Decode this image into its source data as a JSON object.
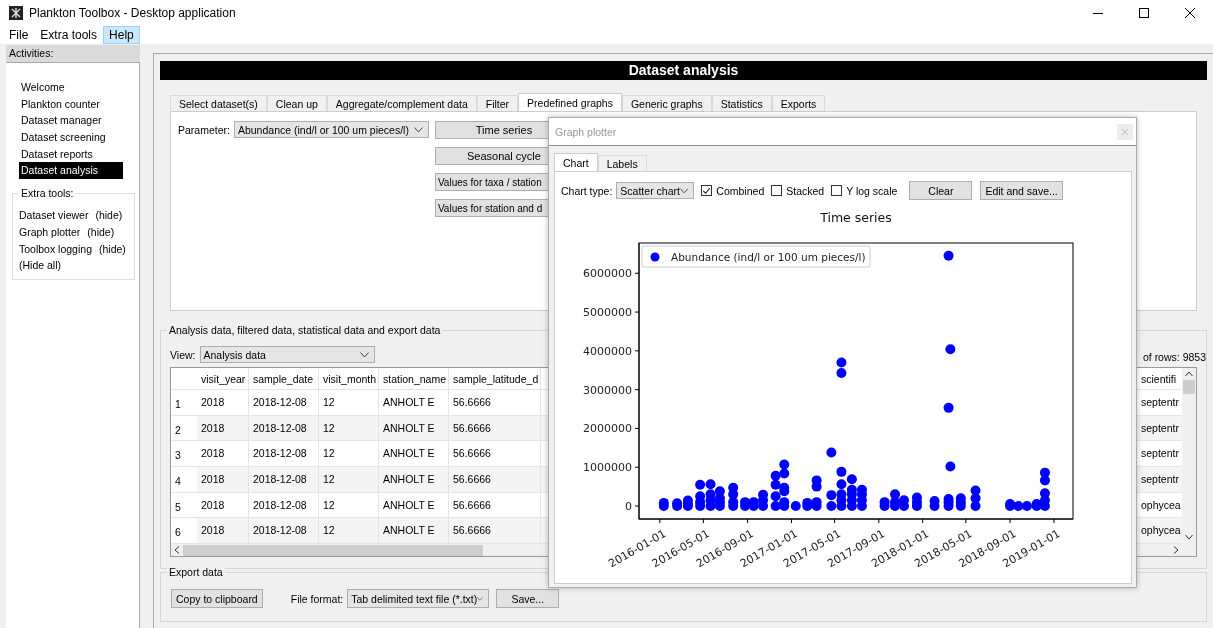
{
  "window": {
    "title": "Plankton Toolbox - Desktop application"
  },
  "menu": [
    {
      "label": "File",
      "highlighted": false
    },
    {
      "label": "Extra tools",
      "highlighted": false
    },
    {
      "label": "Help",
      "highlighted": true
    }
  ],
  "sidebar": {
    "header": "Activities:",
    "items": [
      {
        "label": "Welcome",
        "selected": false
      },
      {
        "label": "Plankton counter",
        "selected": false
      },
      {
        "label": "Dataset manager",
        "selected": false
      },
      {
        "label": "Dataset screening",
        "selected": false
      },
      {
        "label": "Dataset reports",
        "selected": false
      },
      {
        "label": "Dataset analysis",
        "selected": true
      }
    ],
    "extra_tools": {
      "title": "Extra tools:",
      "items": [
        {
          "label": "Dataset viewer",
          "action": "(hide)"
        },
        {
          "label": "Graph plotter",
          "action": "(hide)"
        },
        {
          "label": "Toolbox logging",
          "action": "(hide)"
        },
        {
          "label": "(Hide all)"
        }
      ]
    }
  },
  "main": {
    "header": "Dataset analysis",
    "tabs": [
      {
        "label": "Select dataset(s)",
        "selected": false
      },
      {
        "label": "Clean up",
        "selected": false
      },
      {
        "label": "Aggregate/complement data",
        "selected": false
      },
      {
        "label": "Filter",
        "selected": false
      },
      {
        "label": "Predefined graphs",
        "selected": true
      },
      {
        "label": "Generic graphs",
        "selected": false
      },
      {
        "label": "Statistics",
        "selected": false
      },
      {
        "label": "Exports",
        "selected": false
      }
    ],
    "parameter": {
      "label": "Parameter:",
      "value": "Abundance (ind/l or 100 um pieces/l)"
    },
    "graph_buttons": [
      "Time series",
      "Seasonal cycle",
      "Values for taxa / station",
      "Values for station and d"
    ]
  },
  "analysis_data": {
    "title": "Analysis data, filtered data, statistical data and export data",
    "view": {
      "label": "View:",
      "value": "Analysis data"
    },
    "row_count": "of rows: 9853",
    "table": {
      "columns": [
        "visit_year",
        "sample_date",
        "visit_month",
        "station_name",
        "sample_latitude_d",
        "scientifi"
      ],
      "rows": [
        {
          "number": "1",
          "cells": [
            "2018",
            "2018-12-08",
            "12",
            "ANHOLT E",
            "56.6666",
            "septentr"
          ]
        },
        {
          "number": "2",
          "cells": [
            "2018",
            "2018-12-08",
            "12",
            "ANHOLT E",
            "56.6666",
            "septentr"
          ]
        },
        {
          "number": "3",
          "cells": [
            "2018",
            "2018-12-08",
            "12",
            "ANHOLT E",
            "56.6666",
            "septentr"
          ]
        },
        {
          "number": "4",
          "cells": [
            "2018",
            "2018-12-08",
            "12",
            "ANHOLT E",
            "56.6666",
            "septentr"
          ]
        },
        {
          "number": "5",
          "cells": [
            "2018",
            "2018-12-08",
            "12",
            "ANHOLT E",
            "56.6666",
            "ophycea"
          ]
        },
        {
          "number": "6",
          "cells": [
            "2018",
            "2018-12-08",
            "12",
            "ANHOLT E",
            "56.6666",
            "ophycea"
          ]
        }
      ]
    }
  },
  "export": {
    "title": "Export data",
    "copy_button": "Copy to clipboard",
    "format": {
      "label": "File format:",
      "value": "Tab delimited text file (*.txt)"
    },
    "save_button": "Save..."
  },
  "graph_plotter": {
    "title": "Graph plotter",
    "tabs": [
      {
        "label": "Chart",
        "selected": true
      },
      {
        "label": "Labels",
        "selected": false
      }
    ],
    "chart_type": {
      "label": "Chart type:",
      "value": "Scatter chart"
    },
    "options": [
      {
        "label": "Combined",
        "checked": true
      },
      {
        "label": "Stacked",
        "checked": false
      },
      {
        "label": "Y log scale",
        "checked": false
      }
    ],
    "buttons": [
      "Clear",
      "Edit and save..."
    ],
    "chart_data": {
      "type": "scatter",
      "title": "Time series",
      "x": [
        "2016-01-12",
        "2016-01-12",
        "2016-02-18",
        "2016-02-18",
        "2016-03-19",
        "2016-03-19",
        "2016-03-19",
        "2016-04-22",
        "2016-04-22",
        "2016-04-22",
        "2016-04-22",
        "2016-05-21",
        "2016-05-21",
        "2016-05-21",
        "2016-05-21",
        "2016-06-16",
        "2016-06-16",
        "2016-06-16",
        "2016-06-16",
        "2016-07-23",
        "2016-07-23",
        "2016-07-23",
        "2016-07-23",
        "2016-08-25",
        "2016-08-25",
        "2016-09-18",
        "2016-09-18",
        "2016-10-14",
        "2016-10-14",
        "2016-10-14",
        "2016-11-18",
        "2016-11-18",
        "2016-11-18",
        "2016-11-18",
        "2016-12-12",
        "2016-12-12",
        "2016-12-12",
        "2016-12-12",
        "2016-12-12",
        "2016-12-12",
        "2017-01-13",
        "2017-02-14",
        "2017-02-14",
        "2017-03-12",
        "2017-03-12",
        "2017-03-12",
        "2017-03-12",
        "2017-04-22",
        "2017-04-22",
        "2017-04-22",
        "2017-05-20",
        "2017-05-20",
        "2017-05-20",
        "2017-05-20",
        "2017-05-20",
        "2017-05-20",
        "2017-05-20",
        "2017-06-18",
        "2017-06-18",
        "2017-06-18",
        "2017-06-18",
        "2017-06-18",
        "2017-07-16",
        "2017-07-16",
        "2017-07-16",
        "2017-07-16",
        "2017-09-17",
        "2017-09-17",
        "2017-10-16",
        "2017-10-16",
        "2017-10-16",
        "2017-11-10",
        "2017-11-10",
        "2017-12-16",
        "2017-12-16",
        "2017-12-16",
        "2018-02-03",
        "2018-02-03",
        "2018-03-14",
        "2018-03-14",
        "2018-03-14",
        "2018-03-14",
        "2018-03-14",
        "2018-03-19",
        "2018-03-19",
        "2018-04-17",
        "2018-04-17",
        "2018-04-17",
        "2018-05-28",
        "2018-05-28",
        "2018-05-28",
        "2018-09-01",
        "2018-09-01",
        "2018-09-24",
        "2018-10-18",
        "2018-11-14",
        "2018-11-14",
        "2018-12-07",
        "2018-12-07",
        "2018-12-07",
        "2018-12-07",
        "2018-12-07"
      ],
      "series": [
        {
          "name": "Abundance (ind/l or 100 um pieces/l)",
          "color": "#0000ff",
          "values": [
            0,
            80000,
            0,
            70000,
            0,
            50000,
            140000,
            0,
            100000,
            250000,
            550000,
            0,
            150000,
            300000,
            560000,
            0,
            100000,
            200000,
            380000,
            0,
            100000,
            300000,
            470000,
            0,
            100000,
            0,
            100000,
            0,
            150000,
            290000,
            0,
            250000,
            550000,
            780000,
            0,
            100000,
            380000,
            470000,
            840000,
            1070000,
            0,
            0,
            80000,
            0,
            100000,
            500000,
            660000,
            0,
            280000,
            1380000,
            0,
            150000,
            300000,
            560000,
            880000,
            3430000,
            3700000,
            0,
            150000,
            300000,
            420000,
            690000,
            0,
            150000,
            300000,
            420000,
            0,
            100000,
            0,
            100000,
            300000,
            0,
            150000,
            0,
            100000,
            220000,
            0,
            130000,
            0,
            100000,
            180000,
            2530000,
            6450000,
            1020000,
            4040000,
            0,
            100000,
            200000,
            0,
            200000,
            400000,
            0,
            50000,
            0,
            0,
            0,
            50000,
            0,
            150000,
            330000,
            660000,
            860000
          ]
        }
      ],
      "xlim": [
        "2015-11-04",
        "2019-02-23"
      ],
      "ylim": [
        -335000,
        6780000
      ],
      "xticks": [
        "2016-01-01",
        "2016-05-01",
        "2016-09-01",
        "2017-01-01",
        "2017-05-01",
        "2017-09-01",
        "2018-01-01",
        "2018-05-01",
        "2018-09-01",
        "2019-01-01"
      ],
      "yticks": [
        0,
        1000000,
        2000000,
        3000000,
        4000000,
        5000000,
        6000000
      ]
    }
  }
}
